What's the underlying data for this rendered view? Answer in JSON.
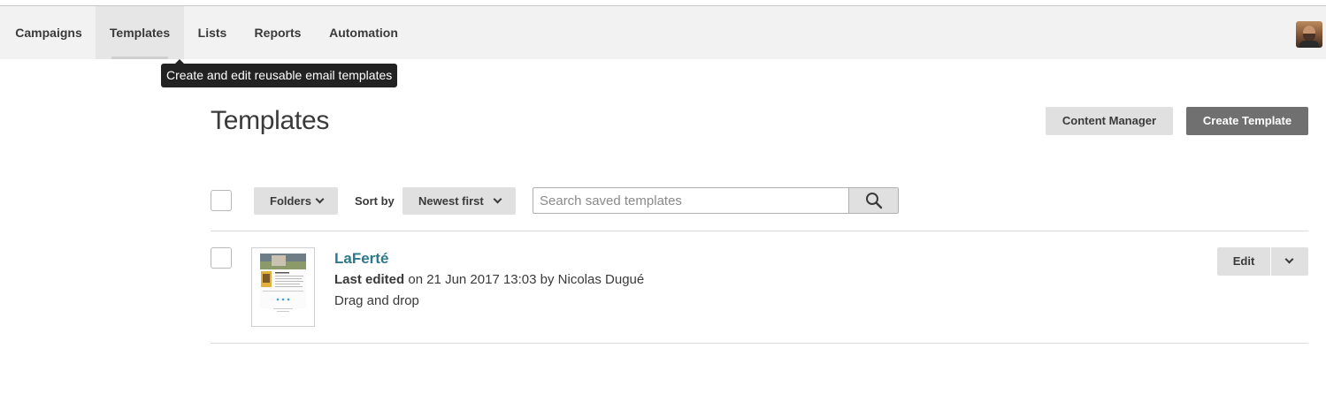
{
  "nav": {
    "items": [
      {
        "label": "Campaigns"
      },
      {
        "label": "Templates"
      },
      {
        "label": "Lists"
      },
      {
        "label": "Reports"
      },
      {
        "label": "Automation"
      }
    ],
    "active": "Templates"
  },
  "tooltip": {
    "text": "Create and edit reusable email templates"
  },
  "page": {
    "title": "Templates"
  },
  "header_buttons": {
    "content_manager": "Content Manager",
    "create_template": "Create Template"
  },
  "toolbar": {
    "folders_label": "Folders",
    "sort_by_label": "Sort by",
    "sort_value": "Newest first",
    "search_placeholder": "Search saved templates"
  },
  "templates": [
    {
      "name": "LaFerté",
      "edited_label": "Last edited",
      "edited_rest": "on 21 Jun 2017 13:03 by Nicolas Dugué",
      "type": "Drag and drop",
      "edit_label": "Edit"
    }
  ],
  "colors": {
    "link": "#2a7a8c",
    "primary_button": "#707070",
    "nav_bg": "#f2f2f2"
  }
}
